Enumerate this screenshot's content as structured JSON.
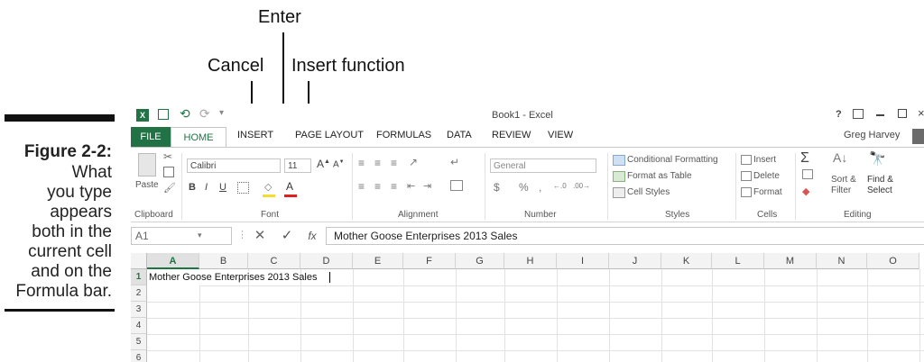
{
  "callouts": {
    "enter": "Enter",
    "cancel": "Cancel",
    "insert_function": "Insert function"
  },
  "caption": {
    "title": "Figure 2-2:",
    "lines": [
      "What",
      "you type",
      "appears",
      "both in the",
      "current cell",
      "and on the",
      "Formula bar."
    ]
  },
  "titlebar": {
    "title": "Book1 - Excel",
    "help": "?",
    "user": "Greg Harvey"
  },
  "tabs": [
    "FILE",
    "HOME",
    "INSERT",
    "PAGE LAYOUT",
    "FORMULAS",
    "DATA",
    "REVIEW",
    "VIEW"
  ],
  "ribbon": {
    "clipboard": {
      "paste": "Paste",
      "label": "Clipboard"
    },
    "font": {
      "name": "Calibri",
      "size": "11",
      "label": "Font",
      "bold": "B",
      "italic": "I",
      "underline": "U"
    },
    "alignment": {
      "label": "Alignment"
    },
    "number": {
      "format": "General",
      "currency": "$",
      "percent": "%",
      "comma": ",",
      "label": "Number"
    },
    "styles": {
      "conditional": "Conditional Formatting",
      "format_table": "Format as Table",
      "cell_styles": "Cell Styles",
      "label": "Styles"
    },
    "cells": {
      "insert": "Insert",
      "delete": "Delete",
      "format": "Format",
      "label": "Cells"
    },
    "editing": {
      "sort": "Sort &",
      "filter": "Filter",
      "find": "Find &",
      "select": "Select",
      "label": "Editing"
    }
  },
  "formula_bar": {
    "namebox": "A1",
    "content": "Mother Goose Enterprises 2013 Sales"
  },
  "sheet": {
    "columns": [
      "A",
      "B",
      "C",
      "D",
      "E",
      "F",
      "G",
      "H",
      "I",
      "J",
      "K",
      "L",
      "M",
      "N",
      "O"
    ],
    "rows": [
      "1",
      "2",
      "3",
      "4",
      "5",
      "6"
    ],
    "a1": "Mother Goose Enterprises 2013 Sales"
  },
  "colors": {
    "excel_green": "#217346",
    "chrome": "#c6c6c6"
  }
}
